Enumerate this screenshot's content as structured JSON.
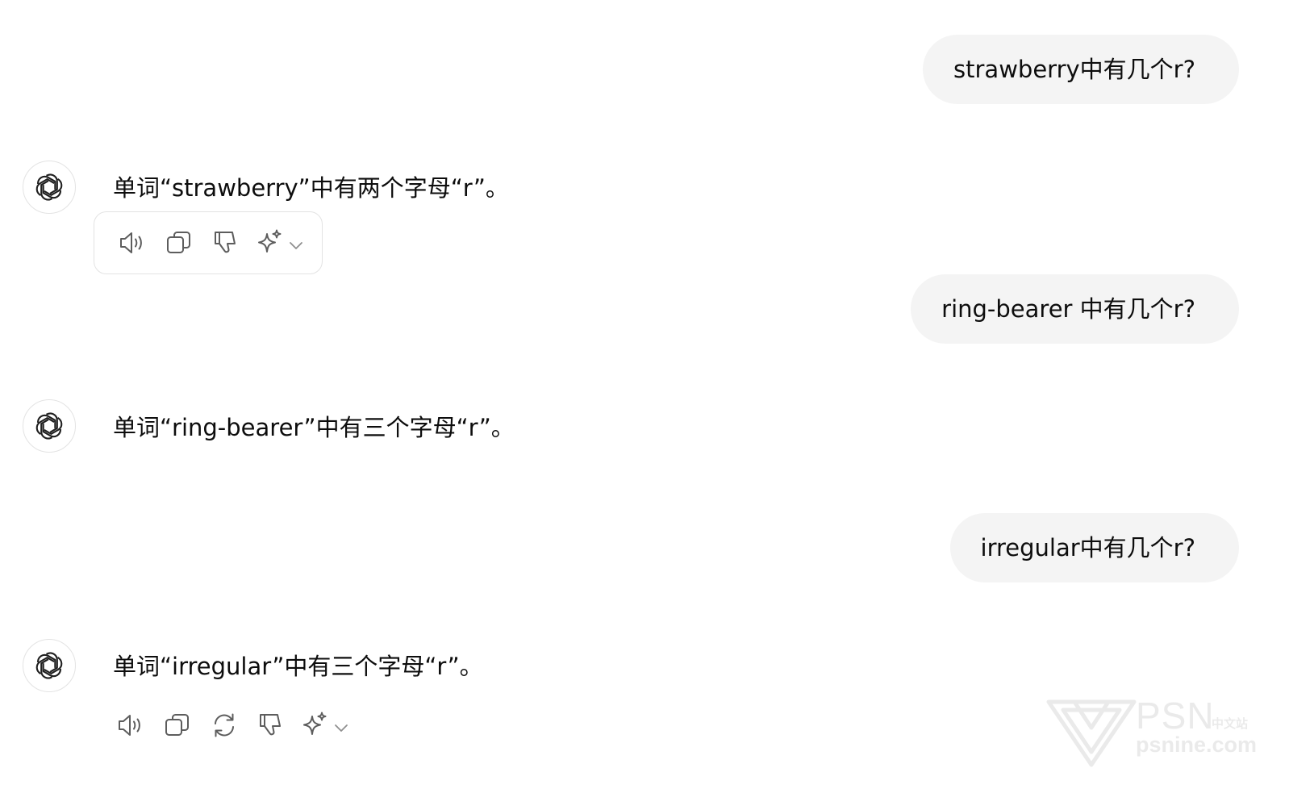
{
  "conversation": {
    "turns": [
      {
        "user": "strawberry中有几个r?",
        "assistant": "单词“strawberry”中有两个字母“r”。"
      },
      {
        "user": "ring-bearer 中有几个r?",
        "assistant": "单词“ring-bearer”中有三个字母“r”。"
      },
      {
        "user": "irregular中有几个r?",
        "assistant": "单词“irregular”中有三个字母“r”。"
      }
    ]
  },
  "actions": {
    "first_toolbar": [
      "read-aloud-icon",
      "copy-icon",
      "thumbs-down-icon",
      "sparkle-icon",
      "chevron-down-icon"
    ],
    "last_toolbar": [
      "read-aloud-icon",
      "copy-icon",
      "regenerate-icon",
      "thumbs-down-icon",
      "sparkle-icon",
      "chevron-down-icon"
    ]
  },
  "watermark": {
    "brand": "PSN",
    "brand_cn": "中文站",
    "domain": "psnine.com"
  },
  "colors": {
    "user_bubble": "#f4f4f4",
    "text": "#0d0d0d",
    "icon": "#5d5d5d",
    "border": "#e3e3e3"
  }
}
